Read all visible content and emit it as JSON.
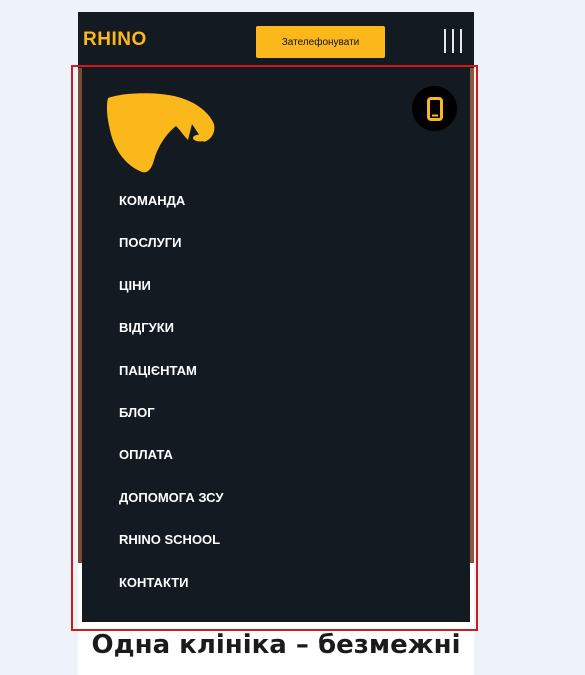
{
  "header": {
    "logo_text": "RHINO",
    "call_button_label": "Зателефонувати"
  },
  "menu": {
    "items": [
      {
        "label": "КОМАНДА"
      },
      {
        "label": "ПОСЛУГИ"
      },
      {
        "label": "ЦІНИ"
      },
      {
        "label": "ВІДГУКИ"
      },
      {
        "label": "ПАЦІЄНТАМ"
      },
      {
        "label": "БЛОГ"
      },
      {
        "label": "ОПЛАТА"
      },
      {
        "label": "ДОПОМОГА ЗСУ"
      },
      {
        "label": "RHINO SCHOOL"
      },
      {
        "label": "КОНТАКТИ"
      }
    ]
  },
  "main": {
    "headline": "Одна клініка – безмежні"
  },
  "colors": {
    "brand_yellow": "#fbb81b",
    "dark_navy": "#131a22",
    "highlight_red": "#d11a1a"
  },
  "icons": {
    "logo": "rhino-logo-icon",
    "phone": "phone-icon",
    "menu": "burger-menu-icon"
  }
}
